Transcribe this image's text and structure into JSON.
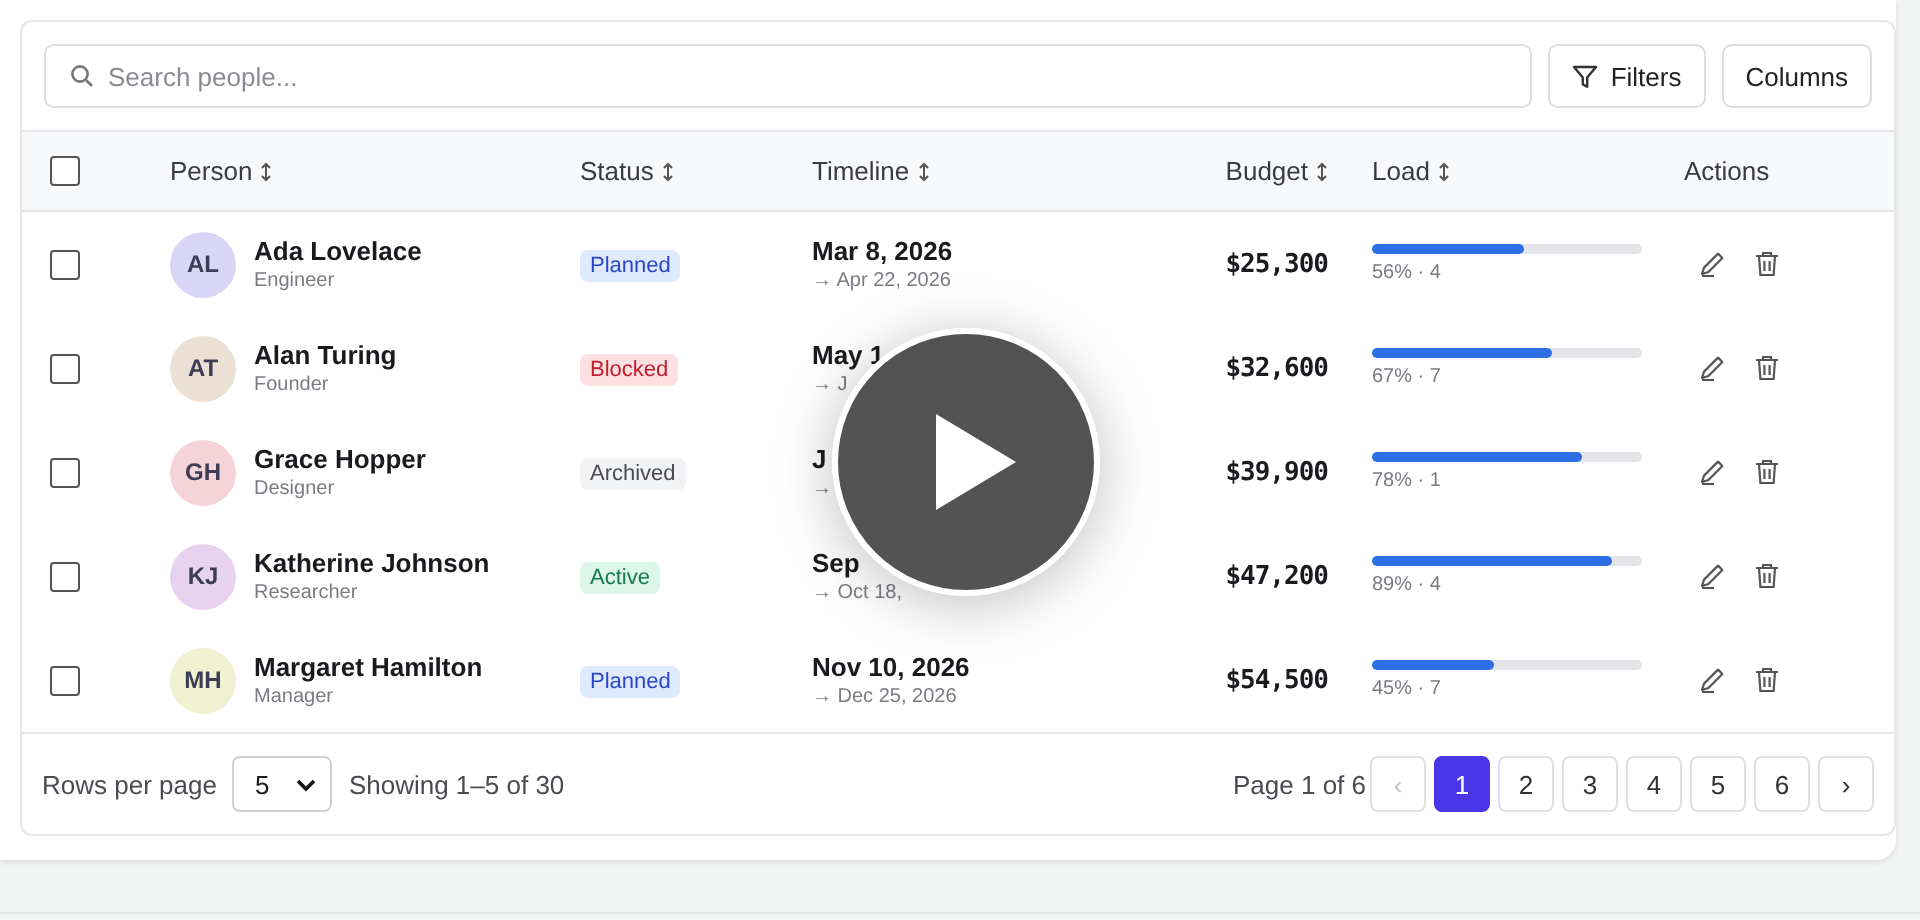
{
  "search": {
    "placeholder": "Search people..."
  },
  "toolbar_buttons": [
    {
      "kind": "filter",
      "label": "Filters"
    },
    {
      "kind": "plain",
      "label": "Columns"
    }
  ],
  "table": {
    "select_all": {
      "checked": false
    },
    "columns": [
      {
        "label": "Person",
        "sortable": true
      },
      {
        "label": "Status",
        "sortable": true
      },
      {
        "label": "Timeline",
        "sortable": true
      },
      {
        "label": "Budget",
        "sortable": true
      },
      {
        "label": "Load",
        "sortable": true
      },
      {
        "label": "Actions",
        "sortable": false
      }
    ],
    "rows": [
      {
        "checked": false,
        "initials": "AL",
        "color": "#d9d5f6",
        "name": "Ada Lovelace",
        "role": "Engineer",
        "status": {
          "label": "Planned",
          "kind": "planned"
        },
        "start": "Mar 8, 2026",
        "end": "→ Apr 22, 2026",
        "budget": "$25,300",
        "level": 0.56,
        "load": "56% · 4"
      },
      {
        "checked": false,
        "initials": "AT",
        "color": "#ecdfd3",
        "name": "Alan Turing",
        "role": "Founder",
        "status": {
          "label": "Blocked",
          "kind": "blocked"
        },
        "start": "May 1",
        "end": "→ J",
        "budget": "$32,600",
        "level": 0.67,
        "load": "67% · 7"
      },
      {
        "checked": false,
        "initials": "GH",
        "color": "#f6d3d8",
        "name": "Grace Hopper",
        "role": "Designer",
        "status": {
          "label": "Archived",
          "kind": "archived"
        },
        "start": "J",
        "end": "→",
        "budget": "$39,900",
        "level": 0.78,
        "load": "78% · 1"
      },
      {
        "checked": false,
        "initials": "KJ",
        "color": "#e7d3f0",
        "name": "Katherine Johnson",
        "role": "Researcher",
        "status": {
          "label": "Active",
          "kind": "active"
        },
        "start": "Sep",
        "end": "→ Oct 18,",
        "budget": "$47,200",
        "level": 0.89,
        "load": "89% · 4"
      },
      {
        "checked": false,
        "initials": "MH",
        "color": "#eff1d0",
        "name": "Margaret Hamilton",
        "role": "Manager",
        "status": {
          "label": "Planned",
          "kind": "planned"
        },
        "start": "Nov 10, 2026",
        "end": "→ Dec 25, 2026",
        "budget": "$54,500",
        "level": 0.45,
        "load": "45% · 7"
      }
    ]
  },
  "footer": {
    "rows_per_page_label": "Rows per page",
    "rows_per_page": "5",
    "showing": "Showing 1–5 of 30",
    "page_label": "Page 1 of 6",
    "prev": {
      "label": "‹",
      "disabled": true
    },
    "pages": [
      {
        "label": "1",
        "selected": true
      },
      {
        "label": "2",
        "selected": false
      },
      {
        "label": "3",
        "selected": false
      },
      {
        "label": "4",
        "selected": false
      },
      {
        "label": "5",
        "selected": false
      },
      {
        "label": "6",
        "selected": false
      }
    ],
    "next": {
      "label": "›",
      "disabled": false
    }
  },
  "video_overlay": {
    "kind": "play"
  }
}
